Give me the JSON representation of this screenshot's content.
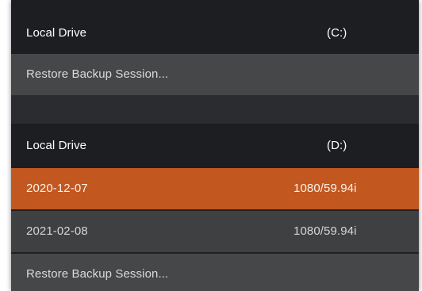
{
  "drives": [
    {
      "header": {
        "name": "Local Drive",
        "letter": "(C:)"
      },
      "sessions": [],
      "restore_label": "Restore Backup Session..."
    },
    {
      "header": {
        "name": "Local Drive",
        "letter": "(D:)"
      },
      "sessions": [
        {
          "name": "2020-12-07",
          "format": "1080/59.94i",
          "selected": true
        },
        {
          "name": "2021-02-08",
          "format": "1080/59.94i",
          "selected": false
        }
      ],
      "restore_label": "Restore Backup Session..."
    }
  ],
  "colors": {
    "selected": "#c2571f",
    "header": "#1c1e21",
    "row": "#3f4042"
  }
}
